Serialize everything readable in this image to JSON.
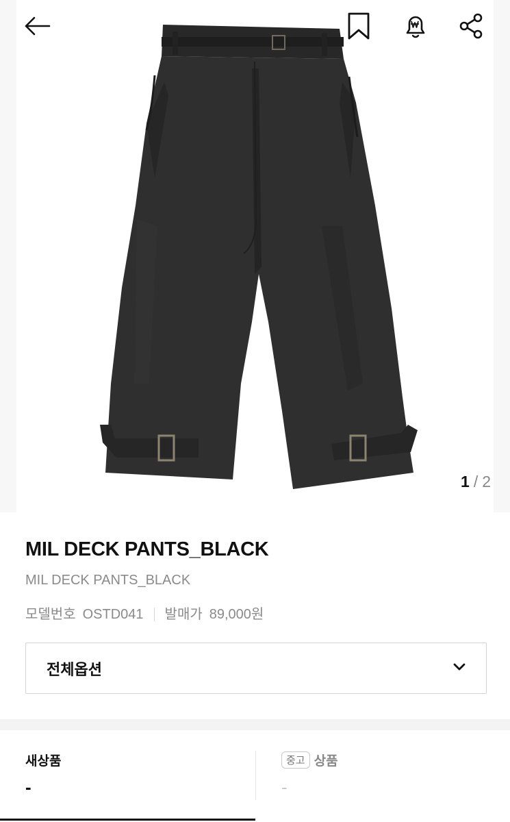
{
  "header": {
    "icons": [
      "back-arrow-icon",
      "bookmark-icon",
      "price-alert-icon",
      "share-icon"
    ]
  },
  "gallery": {
    "current": "1",
    "separator": "/",
    "total": "2"
  },
  "product": {
    "title": "MIL DECK PANTS_BLACK",
    "subtitle": "MIL DECK PANTS_BLACK",
    "model_label": "모델번호",
    "model_value": "OSTD041",
    "price_label": "발매가",
    "price_value": "89,000원"
  },
  "options": {
    "label": "전체옵션"
  },
  "conditions": {
    "new_label": "새상품",
    "new_value": "-",
    "used_badge": "중고",
    "used_label": "상품",
    "used_value": "-"
  },
  "colors": {
    "text": "#111111",
    "muted": "#8a8a8a",
    "border": "#d4d4d4",
    "fabric": "#2d2d2d"
  }
}
